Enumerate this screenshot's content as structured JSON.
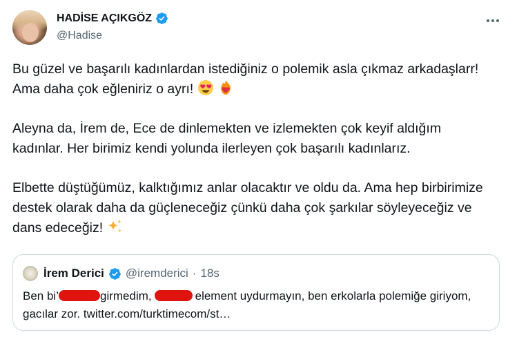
{
  "author": {
    "name": "HADİSE AÇIKGÖZ",
    "handle": "@Hadise",
    "verified_color": "#1d9bf0"
  },
  "tweet": {
    "p1": "Bu güzel ve başarılı kadınlardan istediğiniz o polemik asla çıkmaz arkadaşlarr! Ama daha çok eğleniriz o ayrı!",
    "p1_emojis": [
      "smiling-face-with-heart-eyes",
      "heart-on-fire"
    ],
    "p2": "Aleyna da, İrem de, Ece de dinlemekten ve izlemekten çok keyif aldığım kadınlar. Her birimiz kendi yolunda ilerleyen çok başarılı kadınlarız.",
    "p3": "Elbette düştüğümüz, kalktığımız anlar olacaktır ve oldu da. Ama hep birbirimize destek olarak daha da güçleneceğiz çünkü daha çok şarkılar söyleyeceğiz ve dans edeceğiz!",
    "p3_emojis": [
      "sparkles"
    ]
  },
  "quoted": {
    "name": "İrem Derici",
    "handle": "@iremderici",
    "separator": "·",
    "time": "18s",
    "text_a": "Ben bi’",
    "text_b": "girmedim,",
    "text_c": "element uydurmayın, ben erkolarla polemiğe giriyom, gacılar zor. twitter.com/turktimecom/st…",
    "redaction_color": "#e0140f"
  }
}
